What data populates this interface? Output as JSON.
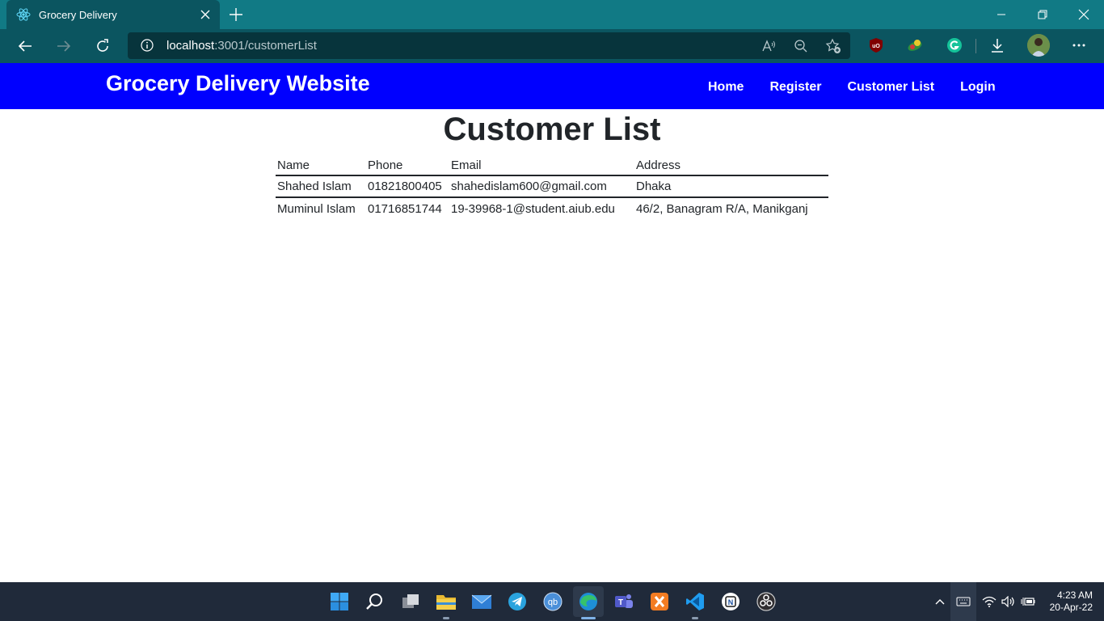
{
  "browser": {
    "tab_title": "Grocery Delivery",
    "url_host": "localhost",
    "url_rest": ":3001/customerList"
  },
  "site": {
    "brand": "Grocery Delivery Website",
    "nav": [
      "Home",
      "Register",
      "Customer List",
      "Login"
    ]
  },
  "page": {
    "title": "Customer List",
    "table": {
      "headers": [
        "Name",
        "Phone",
        "Email",
        "Address"
      ],
      "rows": [
        [
          "Shahed Islam",
          "01821800405",
          "shahedislam600@gmail.com",
          "Dhaka"
        ],
        [
          "Muminul Islam",
          "01716851744",
          "19-39968-1@student.aiub.edu",
          "46/2, Banagram R/A, Manikganj"
        ]
      ]
    }
  },
  "taskbar": {
    "time": "4:23 AM",
    "date": "20-Apr-22"
  },
  "colors": {
    "navbar": "#0000ff",
    "titlebar": "#117a85",
    "toolbar": "#0b5560",
    "taskbar": "#202a3a"
  }
}
